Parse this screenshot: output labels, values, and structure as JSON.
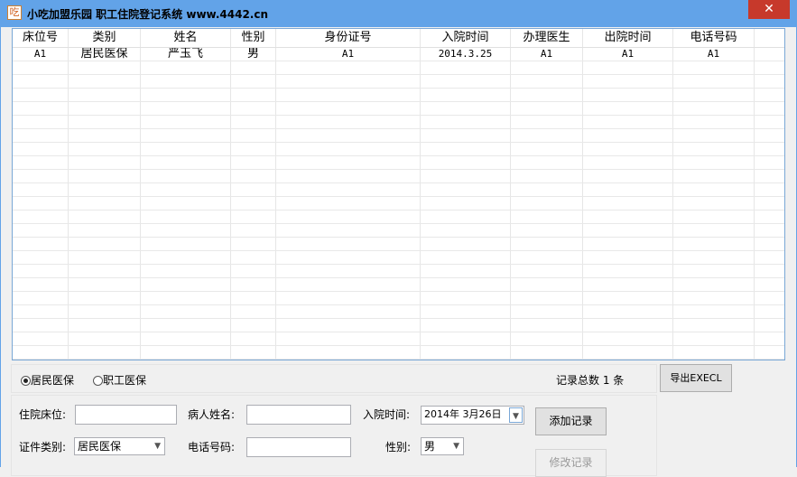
{
  "window": {
    "title": "小吃加盟乐园 职工住院登记系统  www.4442.cn",
    "icon_char": "吃",
    "close": "✕"
  },
  "table": {
    "columns": [
      "床位号",
      "类别",
      "姓名",
      "性别",
      "身份证号",
      "入院时间",
      "办理医生",
      "出院时间",
      "电话号码"
    ],
    "rows": [
      [
        "A1",
        "居民医保",
        "严玉飞",
        "男",
        "A1",
        "2014.3.25",
        "A1",
        "A1",
        "A1"
      ]
    ]
  },
  "filter": {
    "radio1": "居民医保",
    "radio2": "职工医保",
    "radio1_checked": true,
    "record_count": "记录总数 1 条",
    "export": "导出EXECL"
  },
  "form": {
    "bed_label": "住院床位:",
    "bed_value": "",
    "name_label": "病人姓名:",
    "name_value": "",
    "admit_label": "入院时间:",
    "admit_value": "2014年  3月26日",
    "id_type_label": "证件类别:",
    "id_type_value": "居民医保",
    "phone_label": "电话号码:",
    "phone_value": "",
    "gender_label": "性别:",
    "gender_value": "男",
    "add_button": "添加记录",
    "edit_button": "修改记录"
  }
}
